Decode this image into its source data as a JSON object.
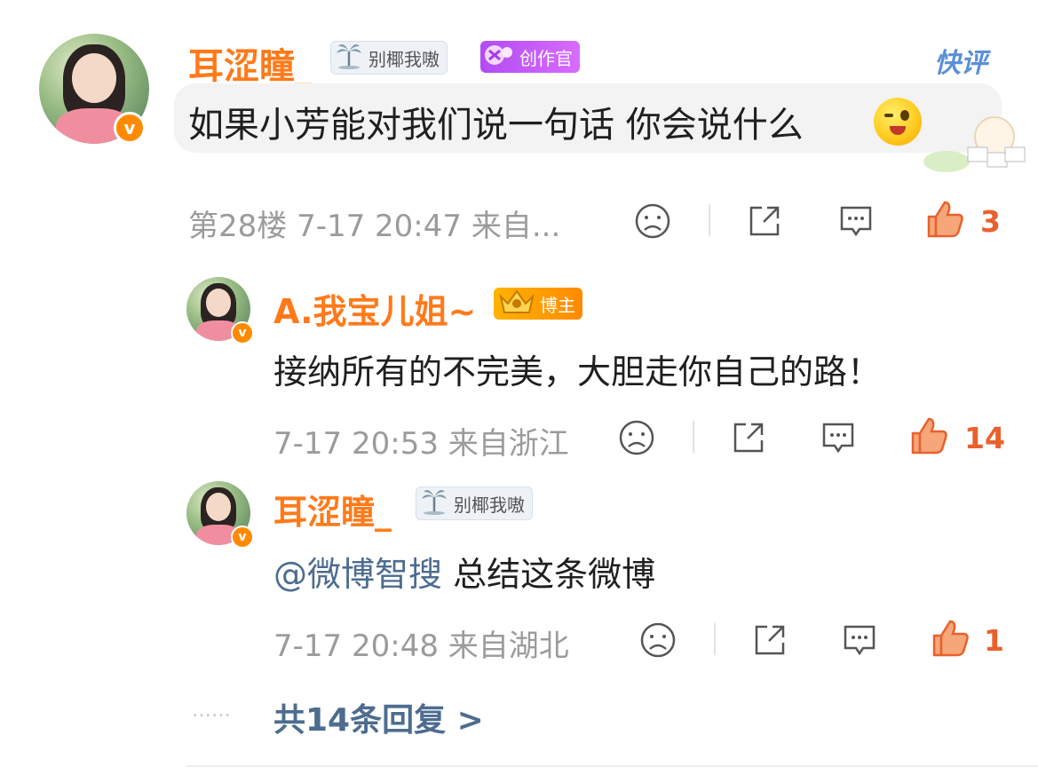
{
  "comment": {
    "username": "耳涩瞳_",
    "tag_label": "别椰我嗷",
    "creator_label": "创作官",
    "quick_reply_label": "快评",
    "text": "如果小芳能对我们说一句话 你会说什么",
    "meta": "第28楼 7-17 20:47 来自...",
    "likes": "3"
  },
  "replies": [
    {
      "username": "A.我宝儿姐~",
      "badge_label": "博主",
      "text": "接纳所有的不完美，大胆走你自己的路！",
      "meta": "7-17 20:53 来自浙江",
      "likes": "14"
    },
    {
      "username": "耳涩瞳_",
      "tag_label": "别椰我嗷",
      "mention": "@微博智搜",
      "text": "总结这条微博",
      "meta": "7-17 20:48 来自湖北",
      "likes": "1"
    }
  ],
  "more_dots": "……",
  "more_replies": "共14条回复 >",
  "colors": {
    "username": "#ff7a1a",
    "like": "#e8612c",
    "mention": "#4d6c8f",
    "meta": "#9b9b9b"
  },
  "icons": [
    "sad-face-icon",
    "share-icon",
    "comment-icon",
    "thumbs-up-icon",
    "verified-v-icon",
    "palm-tree-icon"
  ]
}
